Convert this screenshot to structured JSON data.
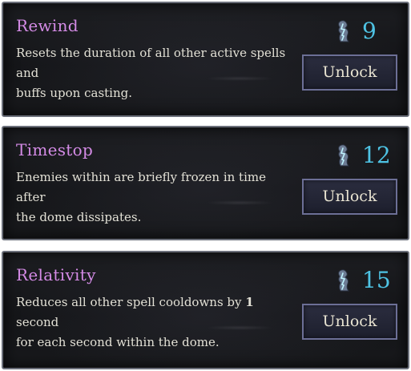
{
  "spells": [
    {
      "name": "Rewind",
      "description": [
        "Resets the duration of all other active spells and",
        "buffs upon casting."
      ],
      "cost": "9",
      "button_label": "Unlock"
    },
    {
      "name": "Timestop",
      "description": [
        "Enemies within are briefly frozen in time after",
        "the dome dissipates."
      ],
      "cost": "12",
      "button_label": "Unlock"
    },
    {
      "name": "Relativity",
      "description": [
        "Reduces all other spell cooldowns by ",
        "1",
        " second",
        "for each second within the dome."
      ],
      "cost": "15",
      "button_label": "Unlock"
    }
  ],
  "colors": {
    "spell_name": "#d48be6",
    "description": "#e3e1d6",
    "cost": "#4ec3e4",
    "card_bg": "#16171a",
    "button_border": "#6c6f96"
  },
  "icons": {
    "cost": "crystal-currency-icon"
  }
}
